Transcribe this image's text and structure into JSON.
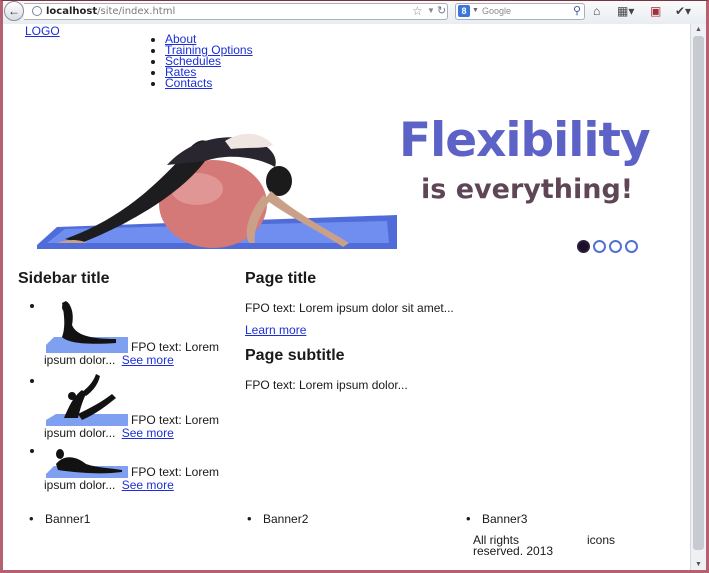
{
  "browser": {
    "url_host": "localhost",
    "url_path": "/site/index.html",
    "search_placeholder": "Google",
    "search_engine_letter": "8"
  },
  "site": {
    "logo": "LOGO",
    "nav": [
      "About",
      "Training Options",
      "Schedules",
      "Rates",
      "Contacts"
    ],
    "hero": {
      "headline": "Flexibility",
      "tagline": "is everything!",
      "slide_count": 4,
      "active_slide": 1
    },
    "sidebar": {
      "title": "Sidebar title",
      "items": [
        {
          "text": "FPO text: Lorem",
          "text2": "ipsum dolor...",
          "see": "See",
          "more": "more"
        },
        {
          "text": "FPO text: Lorem",
          "text2": "ipsum dolor...",
          "see": "See",
          "more": "more"
        },
        {
          "text": "FPO text: Lorem",
          "text2": "ipsum dolor...",
          "see": "See",
          "more": "more"
        }
      ]
    },
    "main": {
      "title": "Page title",
      "paragraph": "FPO text: Lorem ipsum dolor sit amet...",
      "learn_more": "Learn more",
      "subtitle": "Page subtitle",
      "paragraph2": "FPO text: Lorem ipsum dolor..."
    },
    "banners": [
      "Banner1",
      "Banner2",
      "Banner3"
    ],
    "footer": {
      "copyright": "All rights reserved. 2013",
      "icons": "icons"
    }
  },
  "colors": {
    "headline": "#5c62c6",
    "tagline": "#5e4656",
    "link": "#1c2fd6",
    "frame": "#b5606e"
  }
}
